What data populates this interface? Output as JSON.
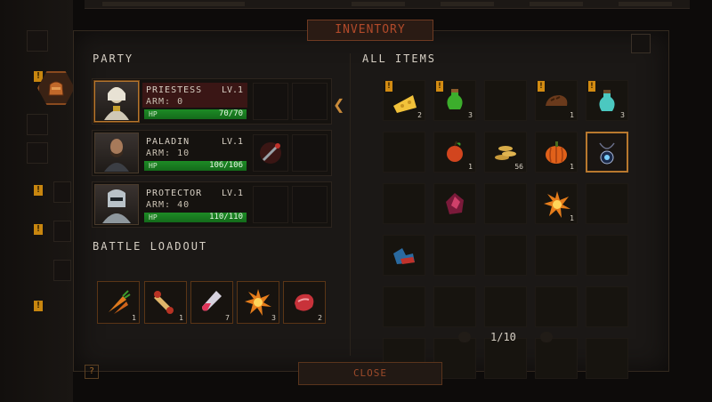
{
  "window": {
    "title": "INVENTORY",
    "close_label": "CLOSE",
    "help_label": "?"
  },
  "party": {
    "title": "PARTY",
    "members": [
      {
        "name": "PRIESTESS",
        "level": "LV.1",
        "armor": "ARM: 0",
        "hp_label": "HP",
        "hp": "70/70",
        "hp_fraction": 1.0
      },
      {
        "name": "PALADIN",
        "level": "LV.1",
        "armor": "ARM: 10",
        "hp_label": "HP",
        "hp": "106/106",
        "hp_fraction": 1.0
      },
      {
        "name": "PROTECTOR",
        "level": "LV.1",
        "armor": "ARM: 40",
        "hp_label": "HP",
        "hp": "110/110",
        "hp_fraction": 1.0
      }
    ]
  },
  "loadout": {
    "title": "BATTLE LOADOUT",
    "items": [
      {
        "icon": "carrot-icon",
        "qty": "1"
      },
      {
        "icon": "scroll-icon",
        "qty": "1"
      },
      {
        "icon": "potion-vial-icon",
        "qty": "7"
      },
      {
        "icon": "bomb-icon",
        "qty": "3"
      },
      {
        "icon": "meat-icon",
        "qty": "2"
      }
    ]
  },
  "items": {
    "title": "ALL ITEMS",
    "cells": [
      {
        "icon": "cheese-icon",
        "qty": "2",
        "alert": true
      },
      {
        "icon": "green-potion-icon",
        "qty": "3",
        "alert": true
      },
      {
        "icon": "",
        "qty": "",
        "alert": false
      },
      {
        "icon": "bread-icon",
        "qty": "1",
        "alert": true
      },
      {
        "icon": "cyan-potion-icon",
        "qty": "3",
        "alert": true
      },
      {
        "icon": "",
        "qty": "",
        "alert": false
      },
      {
        "icon": "apple-icon",
        "qty": "1",
        "alert": false
      },
      {
        "icon": "coins-icon",
        "qty": "56",
        "alert": false
      },
      {
        "icon": "pumpkin-icon",
        "qty": "1",
        "alert": false
      },
      {
        "icon": "amulet-icon",
        "qty": "",
        "alert": false
      },
      {
        "icon": "",
        "qty": "",
        "alert": false
      },
      {
        "icon": "ruby-shard-icon",
        "qty": "",
        "alert": false
      },
      {
        "icon": "",
        "qty": "",
        "alert": false
      },
      {
        "icon": "bomb-icon",
        "qty": "1",
        "alert": false
      },
      {
        "icon": "",
        "qty": "",
        "alert": false
      },
      {
        "icon": "boots-icon",
        "qty": "",
        "alert": false
      }
    ],
    "page": "1/10"
  },
  "colors": {
    "accent": "#b8782e",
    "alert": "#d28b12",
    "hp": "#1d8b25",
    "title_red": "#b14a2a"
  }
}
